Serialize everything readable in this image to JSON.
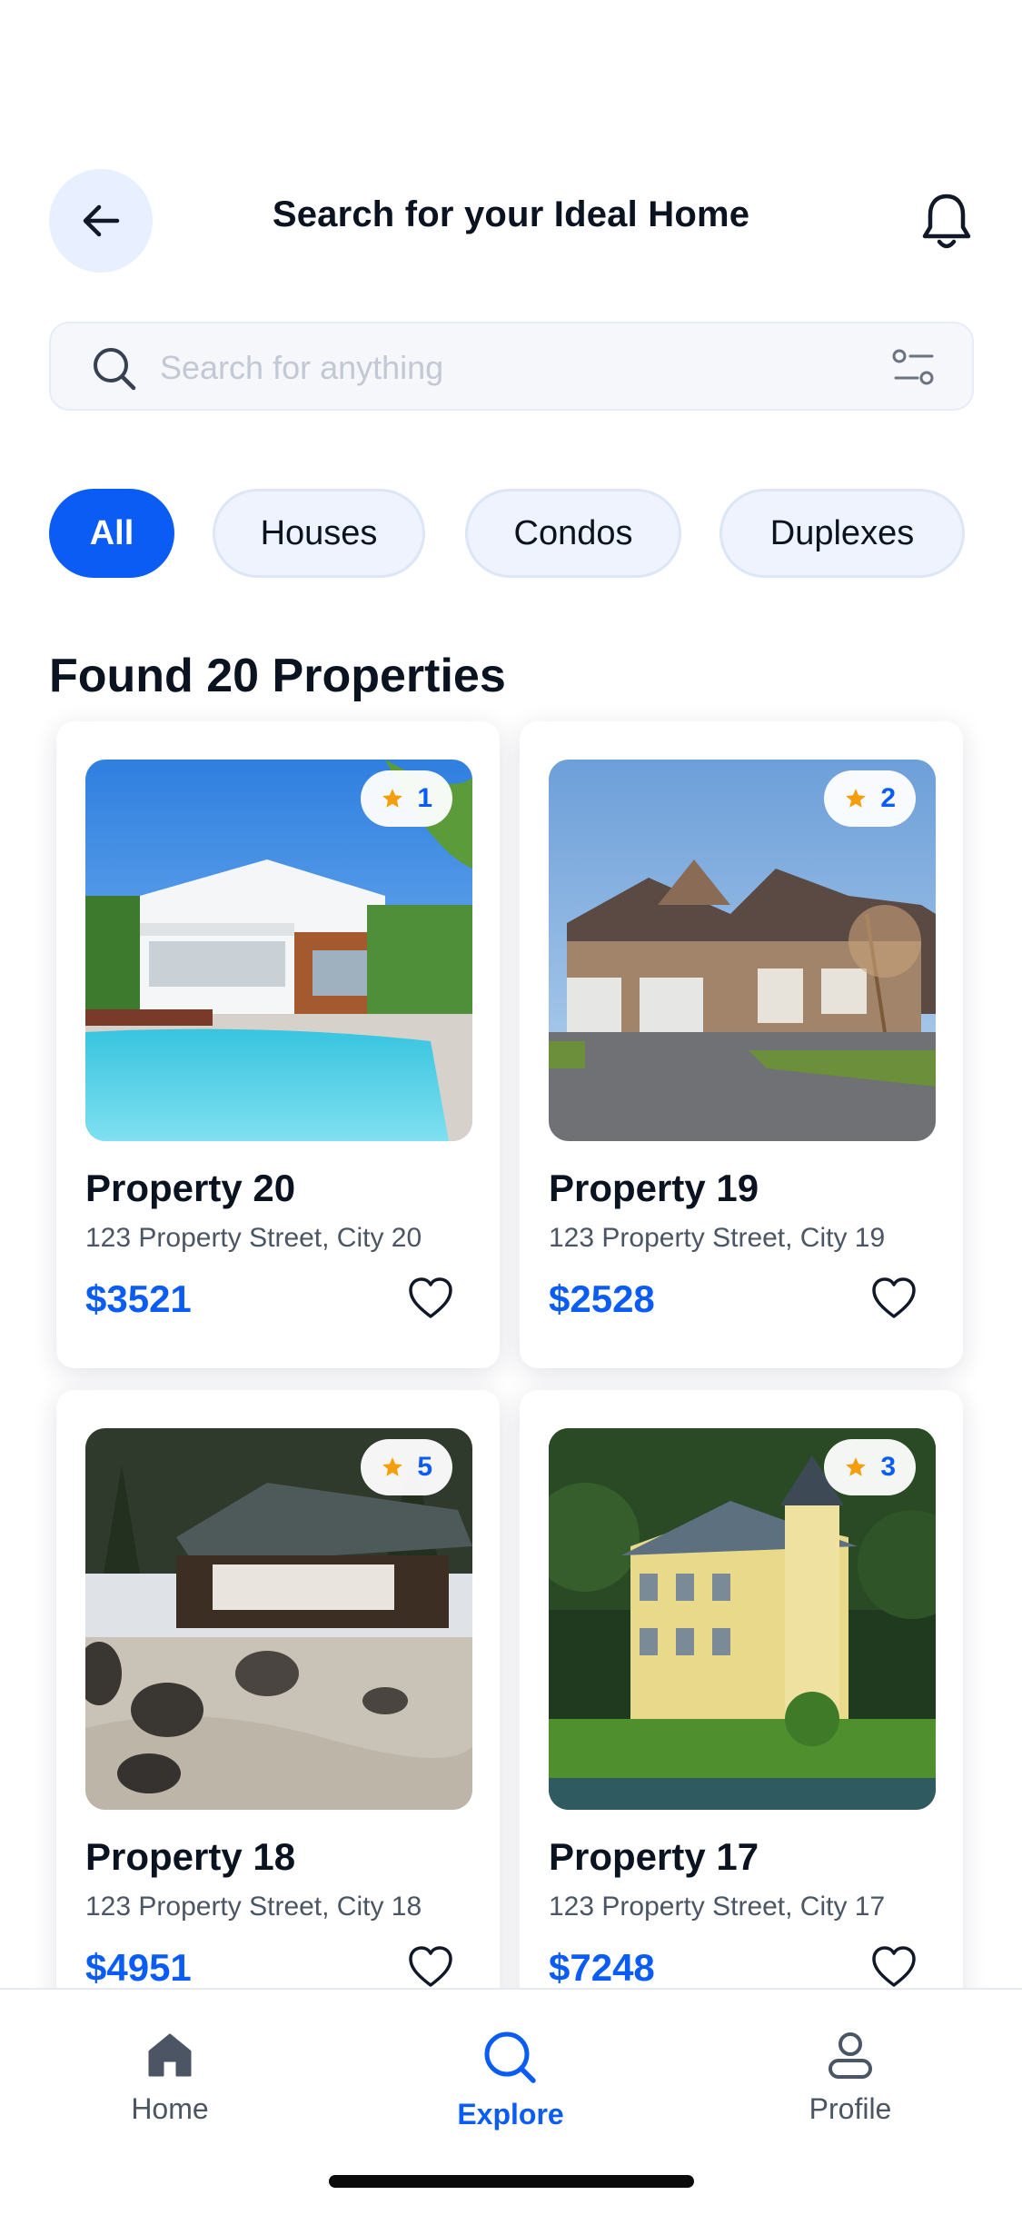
{
  "header": {
    "title": "Search for your Ideal Home",
    "back_icon": "arrow-left-icon",
    "notification_icon": "bell-icon"
  },
  "search": {
    "placeholder": "Search for anything",
    "value": "",
    "search_icon": "search-icon",
    "filter_icon": "filter-sliders-icon"
  },
  "categories": [
    {
      "label": "All",
      "active": true
    },
    {
      "label": "Houses",
      "active": false
    },
    {
      "label": "Condos",
      "active": false
    },
    {
      "label": "Duplexes",
      "active": false
    }
  ],
  "results": {
    "heading": "Found 20 Properties"
  },
  "properties": [
    {
      "name": "Property 20",
      "address": "123 Property Street, City 20",
      "price": "$3521",
      "rating": "1",
      "favorite": false,
      "image": "villa-with-pool"
    },
    {
      "name": "Property 19",
      "address": "123 Property Street, City 19",
      "price": "$2528",
      "rating": "2",
      "favorite": false,
      "image": "brick-suburban-house"
    },
    {
      "name": "Property 18",
      "address": "123 Property Street, City 18",
      "price": "$4951",
      "rating": "5",
      "favorite": false,
      "image": "japanese-zen-house"
    },
    {
      "name": "Property 17",
      "address": "123 Property Street, City 17",
      "price": "$7248",
      "rating": "3",
      "favorite": false,
      "image": "lakeside-mansion"
    }
  ],
  "colors": {
    "accent": "#0a5cf5",
    "star": "#f59e0b",
    "chip_bg": "#eef3fd",
    "back_button_bg": "#e8efff"
  },
  "bottom_nav": [
    {
      "label": "Home",
      "icon": "home-icon",
      "active": false
    },
    {
      "label": "Explore",
      "icon": "search-icon",
      "active": true
    },
    {
      "label": "Profile",
      "icon": "user-icon",
      "active": false
    }
  ]
}
